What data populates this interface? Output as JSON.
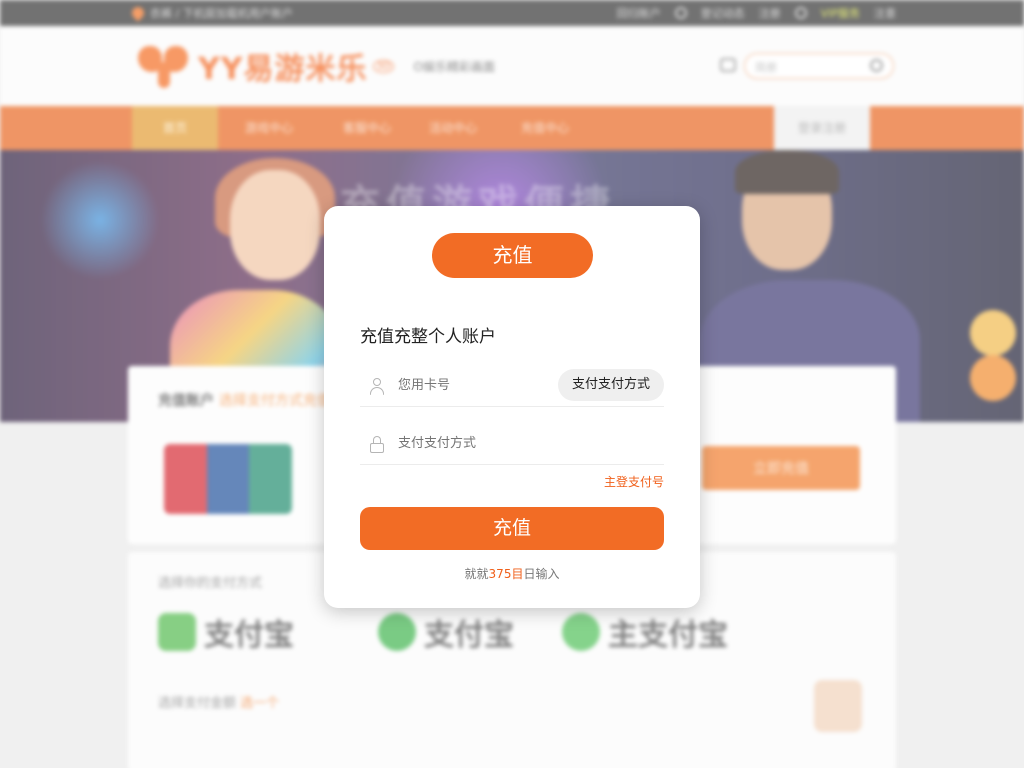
{
  "topbar": {
    "left_text": "衣裤 / 下机层加载机用户账户",
    "right_items": [
      "回归账户",
      "登记动态",
      "注册",
      "VIP服务",
      "注意"
    ]
  },
  "header": {
    "brand": "YY易游米乐",
    "brand_badge": "3D",
    "tagline": "O娱乐精彩画面",
    "search_placeholder": "简册"
  },
  "nav": {
    "items": [
      "首页",
      "游戏中心",
      "客服中心",
      "活动中心",
      "充值中心"
    ],
    "login": "登录注册"
  },
  "banner": {
    "headline": "充值游戏便捷"
  },
  "background": {
    "panel1_title": "充值账户",
    "panel1_title_hint": "选择支付方式充值您的游戏账户",
    "panel1_button": "立即充值",
    "panel2_title": "选择你的支付方式",
    "pay_options": [
      "支付宝",
      "支付宝",
      "主支付宝"
    ],
    "panel2_title2": "选择支付金额",
    "panel2_title2_hint": "选一个"
  },
  "modal": {
    "pill_label": "充值",
    "heading": "充值充整个人账户",
    "field1_placeholder": "您用卡号",
    "field1_button": "支付支付方式",
    "field2_placeholder": "支付支付方式",
    "forgot_link": "主登支付号",
    "submit_label": "充值",
    "footnote_pre": "就就",
    "footnote_highlight": "375目",
    "footnote_post": "日输入"
  },
  "colors": {
    "accent": "#f26c25",
    "nav": "#e8641c",
    "topbar": "#303030"
  }
}
